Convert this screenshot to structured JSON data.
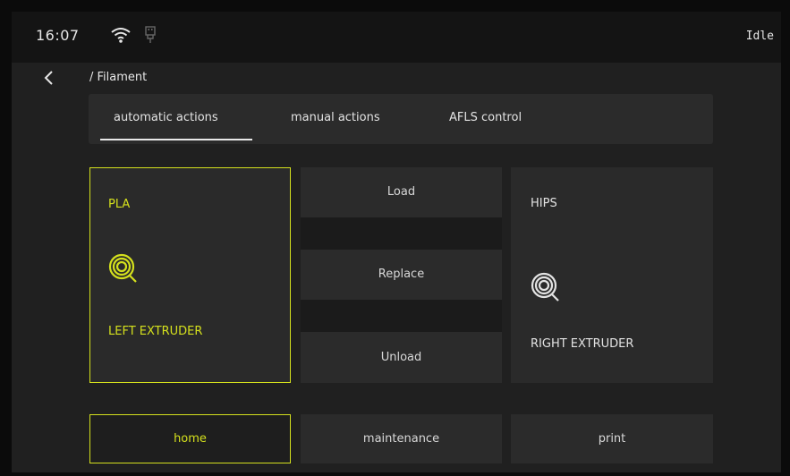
{
  "status": {
    "time": "16:07",
    "state": "Idle",
    "icons": [
      "wifi-icon",
      "usb-icon"
    ]
  },
  "breadcrumb": "/ Filament",
  "tabs": [
    {
      "label": "automatic actions",
      "active": true
    },
    {
      "label": "manual actions",
      "active": false
    },
    {
      "label": "AFLS control",
      "active": false
    }
  ],
  "left_extruder": {
    "material": "PLA",
    "label": "LEFT EXTRUDER",
    "selected": true
  },
  "right_extruder": {
    "material": "HIPS",
    "label": "RIGHT EXTRUDER",
    "selected": false
  },
  "actions": {
    "load": "Load",
    "replace": "Replace",
    "unload": "Unload"
  },
  "bottom_nav": {
    "home": "home",
    "maintenance": "maintenance",
    "print": "print",
    "active": "home"
  },
  "colors": {
    "accent": "#d4e01d",
    "text": "#e3e3e3",
    "panel": "#2b2b2b",
    "background": "#202020"
  }
}
